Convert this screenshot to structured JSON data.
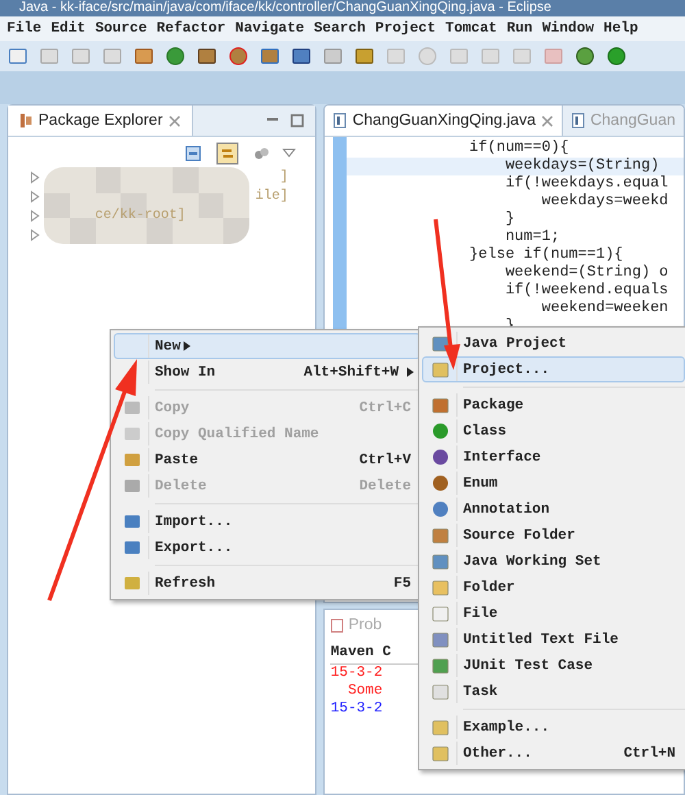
{
  "window": {
    "title": "Java - kk-iface/src/main/java/com/iface/kk/controller/ChangGuanXingQing.java - Eclipse"
  },
  "menubar": [
    "File",
    "Edit",
    "Source",
    "Refactor",
    "Navigate",
    "Search",
    "Project",
    "Tomcat",
    "Run",
    "Window",
    "Help"
  ],
  "package_explorer": {
    "title": "Package Explorer",
    "tree": [
      {
        "text": "]",
        "expanded": false
      },
      {
        "text": "ile]",
        "expanded": false
      },
      {
        "text": "ce/kk-root]",
        "expanded": false
      },
      {
        "expanded": false
      }
    ]
  },
  "editor": {
    "tabs": [
      {
        "label": "ChangGuanXingQing.java",
        "selected": true
      },
      {
        "label": "ChangGuan",
        "selected": false
      }
    ],
    "lines": [
      {
        "text": "            if(num==0){",
        "highlighted": false
      },
      {
        "text": "                weekdays=(String)",
        "highlighted": true
      },
      {
        "text": "                if(!weekdays.equal",
        "highlighted": false
      },
      {
        "text": "                    weekdays=weekd",
        "highlighted": false
      },
      {
        "text": "                }",
        "highlighted": false
      },
      {
        "text": "                num=1;",
        "highlighted": false
      },
      {
        "text": "            }else if(num==1){",
        "highlighted": false
      },
      {
        "text": "                weekend=(String) o",
        "highlighted": false
      },
      {
        "text": "                if(!weekend.equals",
        "highlighted": false
      },
      {
        "text": "                    weekend=weeken",
        "highlighted": false
      },
      {
        "text": "                }",
        "highlighted": false
      }
    ]
  },
  "bottom_panel": {
    "tab": "Prob",
    "console_title": "Maven C",
    "lines": [
      {
        "text": "15-3-2",
        "color": "#ff2020"
      },
      {
        "text": "  Some",
        "color": "#ff2020"
      },
      {
        "text": "15-3-2",
        "color": "#2020ff"
      }
    ]
  },
  "context_menu": [
    {
      "kind": "item",
      "label": "New",
      "submenu": true,
      "selected": true,
      "disabled": false
    },
    {
      "kind": "item",
      "label": "Show In",
      "shortcut": "Alt+Shift+W",
      "submenu": true,
      "selected": false,
      "disabled": false
    },
    {
      "kind": "separator"
    },
    {
      "kind": "item",
      "label": "Copy",
      "shortcut": "Ctrl+C",
      "submenu": false,
      "selected": false,
      "disabled": true
    },
    {
      "kind": "item",
      "label": "Copy Qualified Name",
      "submenu": false,
      "selected": false,
      "disabled": true
    },
    {
      "kind": "item",
      "label": "Paste",
      "shortcut": "Ctrl+V",
      "submenu": false,
      "selected": false,
      "disabled": false
    },
    {
      "kind": "item",
      "label": "Delete",
      "shortcut": "Delete",
      "submenu": false,
      "selected": false,
      "disabled": true
    },
    {
      "kind": "separator"
    },
    {
      "kind": "item",
      "label": "Import...",
      "submenu": false,
      "selected": false,
      "disabled": false
    },
    {
      "kind": "item",
      "label": "Export...",
      "submenu": false,
      "selected": false,
      "disabled": false
    },
    {
      "kind": "separator"
    },
    {
      "kind": "item",
      "label": "Refresh",
      "shortcut": "F5",
      "submenu": false,
      "selected": false,
      "disabled": false
    }
  ],
  "new_submenu": [
    {
      "kind": "item",
      "label": "Java Project",
      "selected": false
    },
    {
      "kind": "item",
      "label": "Project...",
      "selected": true
    },
    {
      "kind": "separator"
    },
    {
      "kind": "item",
      "label": "Package",
      "selected": false
    },
    {
      "kind": "item",
      "label": "Class",
      "selected": false
    },
    {
      "kind": "item",
      "label": "Interface",
      "selected": false
    },
    {
      "kind": "item",
      "label": "Enum",
      "selected": false
    },
    {
      "kind": "item",
      "label": "Annotation",
      "selected": false
    },
    {
      "kind": "item",
      "label": "Source Folder",
      "selected": false
    },
    {
      "kind": "item",
      "label": "Java Working Set",
      "selected": false
    },
    {
      "kind": "item",
      "label": "Folder",
      "selected": false
    },
    {
      "kind": "item",
      "label": "File",
      "selected": false
    },
    {
      "kind": "item",
      "label": "Untitled Text File",
      "selected": false
    },
    {
      "kind": "item",
      "label": "JUnit Test Case",
      "selected": false
    },
    {
      "kind": "item",
      "label": "Task",
      "selected": false
    },
    {
      "kind": "separator"
    },
    {
      "kind": "item",
      "label": "Example...",
      "selected": false
    },
    {
      "kind": "item",
      "label": "Other...",
      "shortcut": "Ctrl+N",
      "selected": false
    }
  ]
}
